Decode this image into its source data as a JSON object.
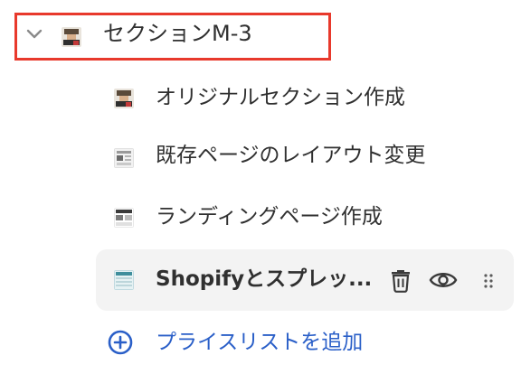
{
  "section": {
    "title": "セクションM-3",
    "collapse_icon": "chevron-down-icon",
    "thumbnail_icon": "section-thumbnail-icon"
  },
  "items": [
    {
      "label": "オリジナルセクション作成",
      "icon": "section-thumbnail-icon"
    },
    {
      "label": "既存ページのレイアウト変更",
      "icon": "page-thumbnail-icon"
    },
    {
      "label": "ランディングページ作成",
      "icon": "page-thumbnail-icon"
    },
    {
      "label": "Shopifyとスプレッ...",
      "icon": "spreadsheet-thumbnail-icon"
    }
  ],
  "selected_item_actions": {
    "delete_icon": "trash-icon",
    "view_icon": "eye-icon",
    "drag_icon": "drag-handle-icon"
  },
  "add_action": {
    "label": "プライスリストを追加",
    "icon": "plus-circle-icon"
  },
  "colors": {
    "highlight_border": "#e8392c",
    "link": "#2a5fc8",
    "text": "#303030",
    "selected_bg": "#f3f3f3"
  }
}
